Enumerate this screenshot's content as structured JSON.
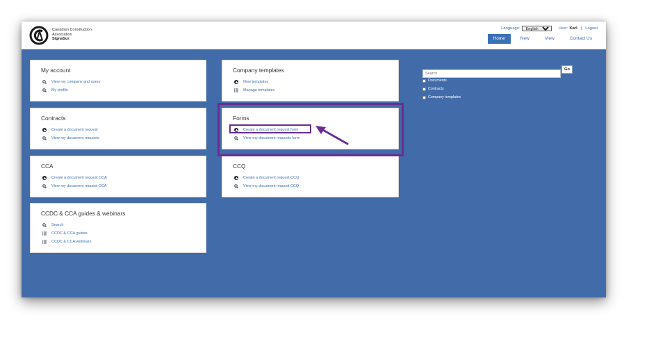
{
  "logo": {
    "line1": "Canadian Construction",
    "line2": "Association",
    "brand": "SignaSur"
  },
  "topbar": {
    "language_label": "Language:",
    "language_value": "English",
    "user_label": "User:",
    "user_name": "Karl",
    "logout": "Logout"
  },
  "nav": [
    "Home",
    "New",
    "View",
    "Contact Us"
  ],
  "cards": {
    "my_account": {
      "title": "My account",
      "links": [
        "View my company and users",
        "My profile"
      ]
    },
    "contracts": {
      "title": "Contracts",
      "links": [
        "Create a document request",
        "View my document requests"
      ]
    },
    "cca": {
      "title": "CCA",
      "links": [
        "Create a document request CCA",
        "View my document request CCA"
      ]
    },
    "guides": {
      "title": "CCDC & CCA guides & webinars",
      "links": [
        "Search",
        "CCDC & CCA guides",
        "CCDC & CCA webinars"
      ]
    },
    "company_templates": {
      "title": "Company templates",
      "links": [
        "New templates",
        "Manage templates"
      ]
    },
    "forms": {
      "title": "Forms",
      "links": [
        "Create a document request form",
        "View my document requests form"
      ]
    },
    "ccq": {
      "title": "CCQ",
      "links": [
        "Create a document request CCQ",
        "View my document request CCQ"
      ]
    }
  },
  "search": {
    "placeholder": "Search",
    "go": "Go",
    "filters": [
      "Documents",
      "Contracts",
      "Company templates"
    ]
  },
  "colors": {
    "main_bg": "#426ba9",
    "link": "#3b6fb6",
    "highlight": "#6a2d8f"
  },
  "icons": {
    "add": "plus-circle-icon",
    "view": "magnifier-icon",
    "manage": "list-icon"
  }
}
